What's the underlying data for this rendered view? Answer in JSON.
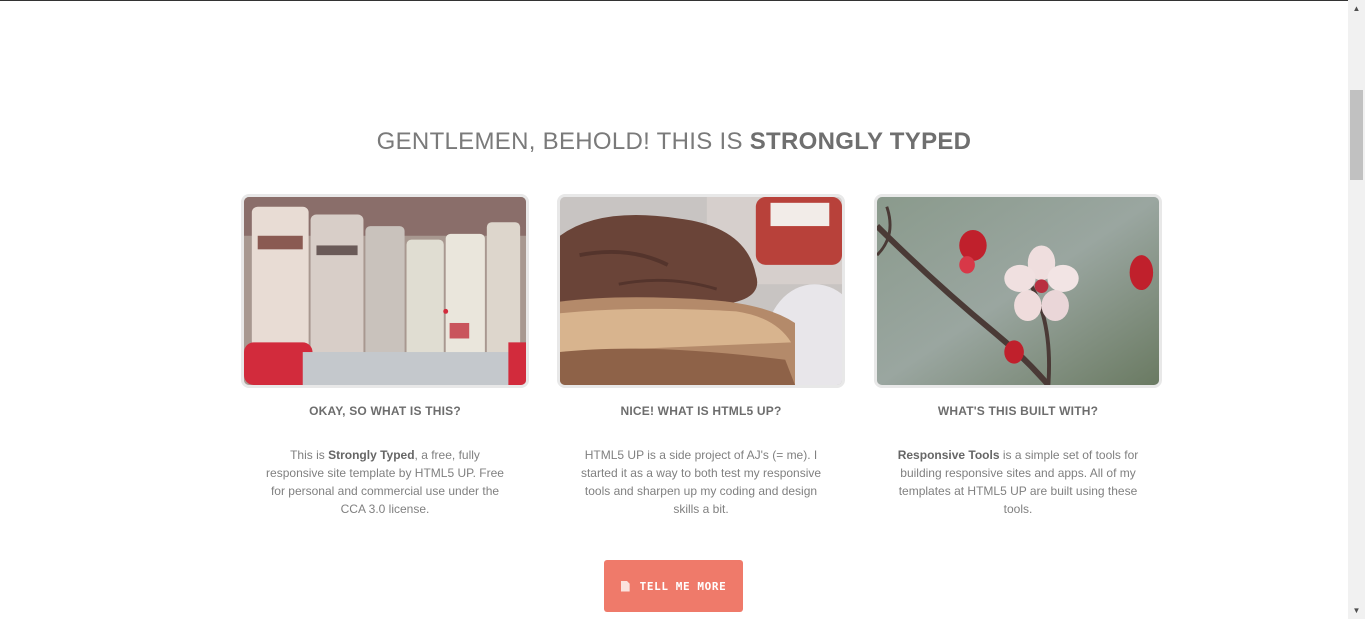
{
  "heading": {
    "prefix": "GENTLEMEN, BEHOLD! THIS IS",
    "emphasis": "STRONGLY TYPED"
  },
  "features": [
    {
      "title": "OKAY, SO WHAT IS THIS?",
      "image_icon": "books-photo",
      "text_pre": "This is ",
      "text_bold": "Strongly Typed",
      "text_post": ", a free, fully responsive site template by HTML5 UP. Free for personal and commercial use under the CCA 3.0 license."
    },
    {
      "title": "NICE! WHAT IS HTML5 UP?",
      "image_icon": "toast-photo",
      "text_pre": "",
      "text_bold": "",
      "text_post": "HTML5 UP is a side project of AJ's (= me). I started it as a way to both test my responsive tools and sharpen up my coding and design skills a bit."
    },
    {
      "title": "WHAT'S THIS BUILT WITH?",
      "image_icon": "blossom-photo",
      "text_pre": "",
      "text_bold": "Responsive Tools",
      "text_post": " is a simple set of tools for building responsive sites and apps. All of my templates at HTML5 UP are built using these tools."
    }
  ],
  "cta": {
    "label": "TELL ME MORE",
    "icon": "document-icon",
    "color": "#ef7a6a"
  },
  "scrollbar": {
    "up_icon": "scroll-up-arrow-icon",
    "down_icon": "scroll-down-arrow-icon"
  }
}
